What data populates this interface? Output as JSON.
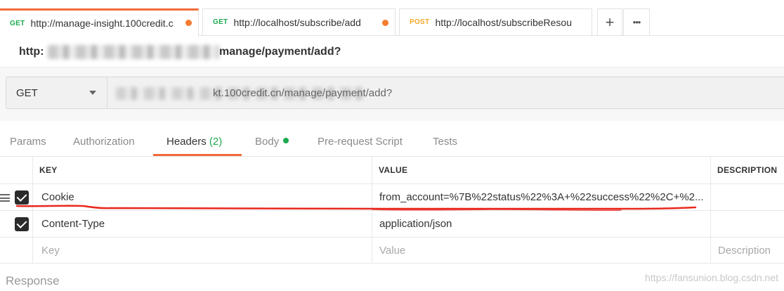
{
  "tabs": [
    {
      "method": "GET",
      "url": "http://manage-insight.100credit.c",
      "active": true
    },
    {
      "method": "GET",
      "url": "http://localhost/subscribe/add",
      "active": false
    },
    {
      "method": "POST",
      "url": "http://localhost/subscribeResou",
      "active": false
    }
  ],
  "tab_actions": {
    "add": "+",
    "more": "•••"
  },
  "request": {
    "name_prefix": "http:",
    "name_suffix": "manage/payment/add?"
  },
  "url_bar": {
    "method": "GET",
    "url_visible": "kt.100credit.cn/manage/payment/add?"
  },
  "subtabs": {
    "params": "Params",
    "authorization": "Authorization",
    "headers": "Headers",
    "headers_count": "(2)",
    "body": "Body",
    "prerequest": "Pre-request Script",
    "tests": "Tests"
  },
  "headers_table": {
    "columns": {
      "key": "KEY",
      "value": "VALUE",
      "description": "DESCRIPTION"
    },
    "rows": [
      {
        "key": "Cookie",
        "value": "from_account=%7B%22status%22%3A+%22success%22%2C+%2...",
        "description": "",
        "checked": true
      },
      {
        "key": "Content-Type",
        "value": "application/json",
        "description": "",
        "checked": true
      }
    ],
    "placeholders": {
      "key": "Key",
      "value": "Value",
      "description": "Description"
    }
  },
  "response": {
    "label": "Response"
  },
  "watermark": "https://fansunion.blog.csdn.net",
  "colors": {
    "accent": "#f26b3a",
    "get": "#1da94f",
    "post": "#f5a623",
    "unsaved_dot": "#f47c2f",
    "annotation": "#e8281e"
  }
}
